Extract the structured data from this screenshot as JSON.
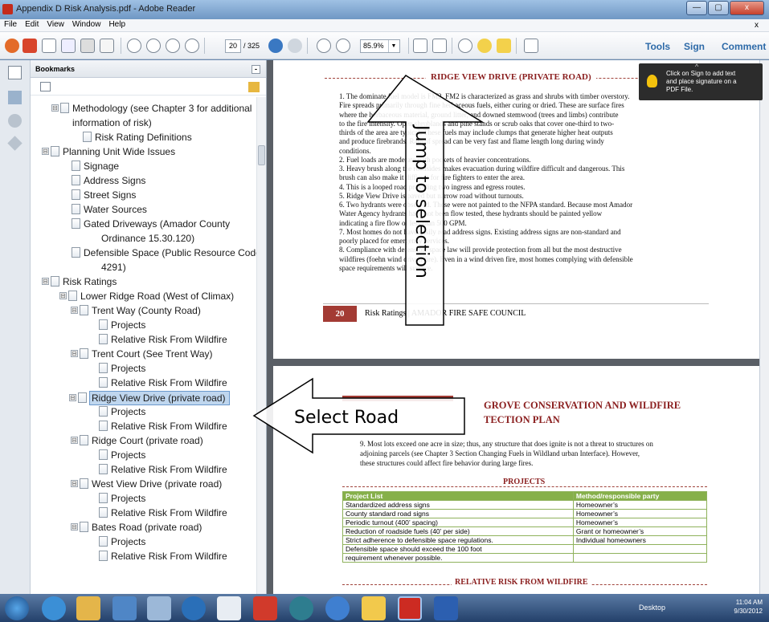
{
  "window": {
    "title": "Appendix D Risk Analysis.pdf - Adobe Reader",
    "close_label": "x"
  },
  "menu": {
    "items": [
      "File",
      "Edit",
      "View",
      "Window",
      "Help"
    ],
    "close_x": "x"
  },
  "toolbar": {
    "page_current": "20",
    "page_total": "/ 325",
    "zoom": "85.9%",
    "tools": "Tools",
    "sign": "Sign",
    "comment": "Comment"
  },
  "bookmarks": {
    "title": "Bookmarks",
    "items": [
      {
        "label": "Methodology (see Chapter 3 for additional",
        "expander": "⊟"
      },
      {
        "label": "information of risk)"
      },
      {
        "label": "Risk Rating Definitions"
      },
      {
        "label": "Planning Unit Wide Issues",
        "expander": "⊟"
      },
      {
        "label": "Signage"
      },
      {
        "label": "Address Signs"
      },
      {
        "label": "Street Signs"
      },
      {
        "label": "Water Sources"
      },
      {
        "label": "Gated Driveways (Amador County"
      },
      {
        "label": "Ordinance 15.30.120)"
      },
      {
        "label": "Defensible Space (Public Resource Code"
      },
      {
        "label": "4291)"
      },
      {
        "label": "Risk Ratings",
        "expander": "⊟"
      },
      {
        "label": "Lower Ridge Road (West of Climax)",
        "expander": "⊟"
      },
      {
        "label": "Trent Way (County Road)",
        "expander": "⊟"
      },
      {
        "label": "Projects"
      },
      {
        "label": "Relative Risk From Wildfire"
      },
      {
        "label": "Trent Court (See Trent Way)",
        "expander": "⊟"
      },
      {
        "label": "Projects"
      },
      {
        "label": "Relative Risk From Wildfire"
      },
      {
        "label": "Ridge View Drive (private road)",
        "expander": "⊟"
      },
      {
        "label": "Projects"
      },
      {
        "label": "Relative Risk From Wildfire"
      },
      {
        "label": "Ridge Court (private road)",
        "expander": "⊟"
      },
      {
        "label": "Projects"
      },
      {
        "label": "Relative Risk From Wildfire"
      },
      {
        "label": "West View Drive (private road)",
        "expander": "⊟"
      },
      {
        "label": "Projects"
      },
      {
        "label": "Relative Risk From Wildfire"
      },
      {
        "label": "Bates Road (private road)",
        "expander": "⊟"
      },
      {
        "label": "Projects"
      },
      {
        "label": "Relative Risk From Wildfire"
      }
    ]
  },
  "page1": {
    "heading": "RIDGE VIEW DRIVE (PRIVATE ROAD)",
    "lines": [
      "1.   The dominate fuel model is FM2.  FM2 is characterized as grass and shrubs with timber overstory.",
      "      Fire spreads primarily through fine herbaceous fuels, either curing or dried.  These are surface fires",
      "      where the herbaceous material, ground litter, and downed stemwood (trees and limbs) contribute",
      "      to the fire intensity. Open shrublands and pine stands or scrub oaks that cover one-third to two-",
      "      thirds of the area are typical. These fuels may include clumps that generate higher heat outputs",
      "      and produce firebrands. Rate of spread can be very fast and flame length long during windy",
      "      conditions.",
      "2.   Fuel loads are moderate with pockets of heavier concentrations.",
      "3.   Heavy brush along the roadsides makes evacuation during wildfire difficult and dangerous.  This",
      "      brush can also make it difficult for fire fighters to enter the area.",
      "4.   This is a looped road providing two ingress and egress routes.",
      "5.   Ridge View Drive is paved but narrow road without turnouts.",
      "6.   Two hydrants were observed.  These were not painted to the NFPA standard.  Because most Amador",
      "      Water Agency hydrants have not been flow tested, these hydrants should be painted yellow",
      "      indicating a fire flow of less than 500 GPM.",
      "7.   Most homes do not have easily read address signs.  Existing address signs are non-standard and",
      "      poorly placed for emergency services.",
      "8.   Compliance with defensible space law will provide protection from all but the most destructive",
      "      wildfires (foehn wind driven fire).  Even in a wind driven fire, most homes complying with defensible",
      "      space requirements will survive."
    ],
    "footer_page": "20",
    "footer_text": "Risk Ratings | AMADOR FIRE SAFE COUNCIL"
  },
  "page2": {
    "heading1": "GROVE CONSERVATION AND WILDFIRE",
    "heading2": "TECTION PLAN",
    "item9": [
      "9.   Most lots exceed one acre in size; thus, any structure that does ignite is not a threat to structures on",
      "      adjoining parcels (see Chapter 3 Section Changing Fuels in Wildland urban Interface).  However,",
      "      these structures could affect fire behavior during large fires."
    ],
    "projects_heading": "PROJECTS",
    "table_header": [
      "Project List",
      "Method/responsible party"
    ],
    "table_rows": [
      [
        "Standardized address signs",
        "Homeowner’s"
      ],
      [
        "County standard road signs",
        "Homeowner’s"
      ],
      [
        "Periodic turnout (400’ spacing)",
        "Homeowner’s"
      ],
      [
        "Reduction of roadside fuels (40’ per side)",
        "Grant or homeowner’s"
      ],
      [
        "Strict adherence to defensible space regulations.",
        "Individual homeowners"
      ],
      [
        "Defensible space should exceed the 100 foot",
        ""
      ],
      [
        "requirement whenever possible.",
        ""
      ]
    ],
    "relative_heading": "RELATIVE RISK FROM WILDFIRE"
  },
  "tooltip": {
    "line1": "Click on Sign to add text",
    "line2": "and place signature on a",
    "line3": "PDF File."
  },
  "annotations": {
    "jump": "Jump to selection",
    "select": "Select Road"
  },
  "taskbar": {
    "desktop": "Desktop",
    "time": "11:04 AM",
    "date": "9/30/2012"
  }
}
